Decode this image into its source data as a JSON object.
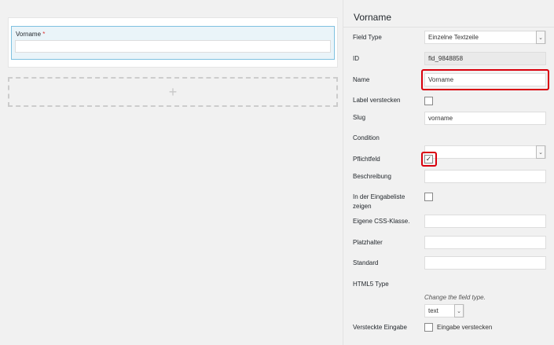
{
  "preview": {
    "field_label": "Vorname",
    "required_mark": "*",
    "add_icon": "+"
  },
  "panel": {
    "title": "Vorname",
    "rows": {
      "field_type": {
        "label": "Field Type",
        "value": "Einzelne Textzeile"
      },
      "id": {
        "label": "ID",
        "value": "fld_9848858"
      },
      "name": {
        "label": "Name",
        "value": "Vorname"
      },
      "hide_label": {
        "label": "Label verstecken",
        "checked": false
      },
      "slug": {
        "label": "Slug",
        "value": "vorname"
      },
      "condition": {
        "label": "Condition",
        "value": ""
      },
      "required": {
        "label": "Pflichtfeld",
        "checked": true,
        "check_glyph": "✓"
      },
      "description": {
        "label": "Beschreibung",
        "value": ""
      },
      "entry_list": {
        "label": "In der Eingabeliste zeigen",
        "checked": false
      },
      "css_class": {
        "label": "Eigene CSS-Klasse.",
        "value": ""
      },
      "placeholder": {
        "label": "Platzhalter",
        "value": ""
      },
      "default": {
        "label": "Standard",
        "value": ""
      },
      "html5_type": {
        "label": "HTML5 Type",
        "value": "text",
        "hint": "Change the field type."
      },
      "hidden_input": {
        "label": "Versteckte Eingabe",
        "checkbox_label": "Eingabe verstecken",
        "checked": false
      }
    }
  },
  "icons": {
    "dropdown_arrow": "⌄"
  },
  "colors": {
    "highlight": "#d9000d",
    "selected_field_bg": "#eaf4f9",
    "selected_field_border": "#7fc1e0",
    "required": "#dc3232"
  }
}
